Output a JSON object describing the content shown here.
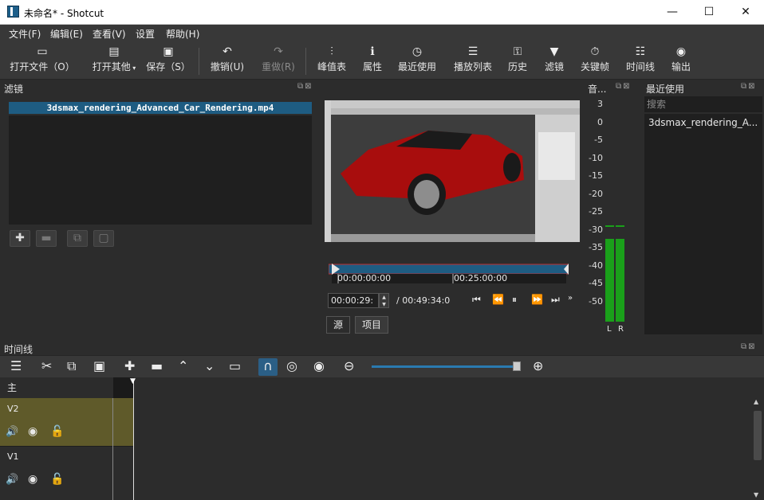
{
  "window": {
    "title": "未命名* - Shotcut",
    "minimize": "—",
    "maximize": "☐",
    "close": "✕"
  },
  "menu": [
    "文件(F)",
    "编辑(E)",
    "查看(V)",
    "设置",
    "帮助(H)"
  ],
  "toolbar": {
    "open_file": "打开文件（O）",
    "open_other": "打开其他",
    "save": "保存（S）",
    "undo": "撤销(U)",
    "redo": "重做(R)",
    "peak_meter": "峰值表",
    "properties": "属性",
    "recent": "最近使用",
    "playlist": "播放列表",
    "history": "历史",
    "filters": "滤镜",
    "keyframes": "关键帧",
    "timeline": "时间线",
    "export": "输出"
  },
  "filters_panel": {
    "title": "滤镜",
    "file": "3dsmax_rendering_Advanced_Car_Rendering.mp4"
  },
  "player": {
    "tc_start": "00:00:00:00",
    "tc_mid": "00:25:00:00",
    "position": "00:00:29:",
    "total": "/ 00:49:34:0",
    "tab_source": "源",
    "tab_project": "项目"
  },
  "audio_panel": {
    "title": "音...",
    "scale": [
      "3",
      "0",
      "-5",
      "-10",
      "-15",
      "-20",
      "-25",
      "-30",
      "-35",
      "-40",
      "-45",
      "-50"
    ],
    "left": "L",
    "right": "R",
    "level_left": 0.37,
    "level_right": 0.37
  },
  "recent_panel": {
    "title": "最近使用",
    "search_placeholder": "搜索",
    "items": [
      "3dsmax_rendering_A..."
    ]
  },
  "timeline": {
    "title": "时间线",
    "tracks": [
      {
        "label": "主"
      },
      {
        "label": "V2"
      },
      {
        "label": "V1"
      }
    ]
  },
  "colors": {
    "accent": "#1e5c82",
    "selected_track": "#5f5a2a",
    "meter": "#1aa01a"
  }
}
